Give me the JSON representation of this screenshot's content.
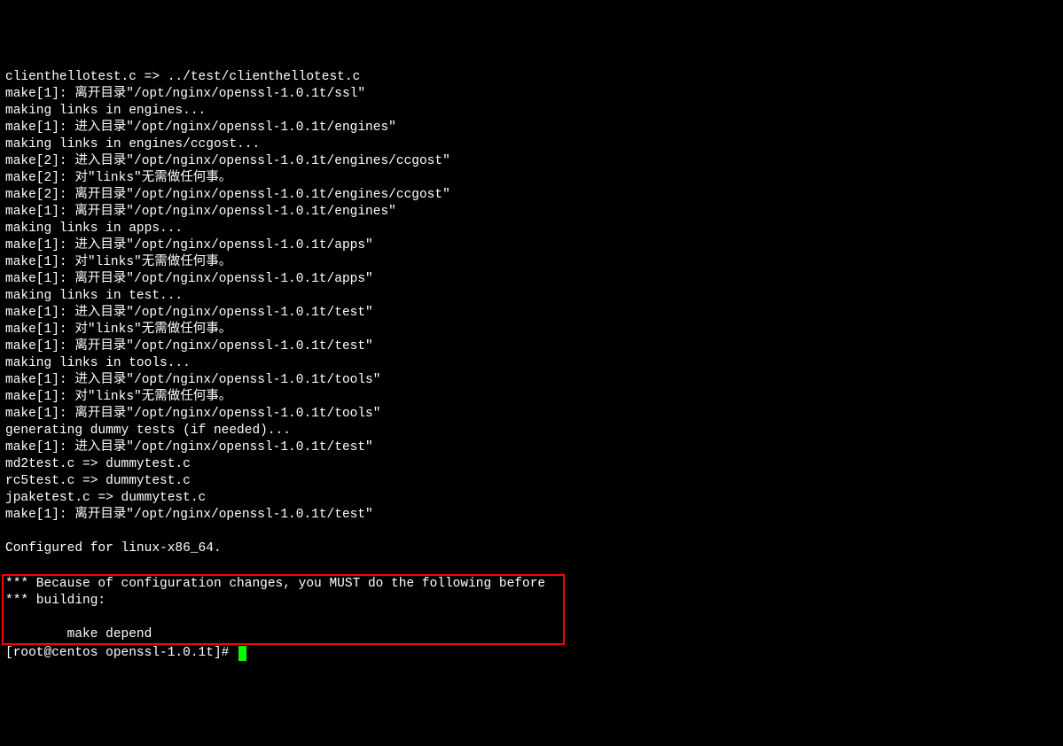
{
  "terminal": {
    "lines": [
      "clienthellotest.c => ../test/clienthellotest.c",
      "make[1]: 离开目录\"/opt/nginx/openssl-1.0.1t/ssl\"",
      "making links in engines...",
      "make[1]: 进入目录\"/opt/nginx/openssl-1.0.1t/engines\"",
      "making links in engines/ccgost...",
      "make[2]: 进入目录\"/opt/nginx/openssl-1.0.1t/engines/ccgost\"",
      "make[2]: 对\"links\"无需做任何事。",
      "make[2]: 离开目录\"/opt/nginx/openssl-1.0.1t/engines/ccgost\"",
      "make[1]: 离开目录\"/opt/nginx/openssl-1.0.1t/engines\"",
      "making links in apps...",
      "make[1]: 进入目录\"/opt/nginx/openssl-1.0.1t/apps\"",
      "make[1]: 对\"links\"无需做任何事。",
      "make[1]: 离开目录\"/opt/nginx/openssl-1.0.1t/apps\"",
      "making links in test...",
      "make[1]: 进入目录\"/opt/nginx/openssl-1.0.1t/test\"",
      "make[1]: 对\"links\"无需做任何事。",
      "make[1]: 离开目录\"/opt/nginx/openssl-1.0.1t/test\"",
      "making links in tools...",
      "make[1]: 进入目录\"/opt/nginx/openssl-1.0.1t/tools\"",
      "make[1]: 对\"links\"无需做任何事。",
      "make[1]: 离开目录\"/opt/nginx/openssl-1.0.1t/tools\"",
      "generating dummy tests (if needed)...",
      "make[1]: 进入目录\"/opt/nginx/openssl-1.0.1t/test\"",
      "md2test.c => dummytest.c",
      "rc5test.c => dummytest.c",
      "jpaketest.c => dummytest.c",
      "make[1]: 离开目录\"/opt/nginx/openssl-1.0.1t/test\"",
      "",
      "Configured for linux-x86_64.",
      ""
    ],
    "highlighted_lines": [
      "*** Because of configuration changes, you MUST do the following before ",
      "*** building:                                                           ",
      "                                                                        ",
      "        make depend                                                     "
    ],
    "prompt": "[root@centos openssl-1.0.1t]# "
  }
}
